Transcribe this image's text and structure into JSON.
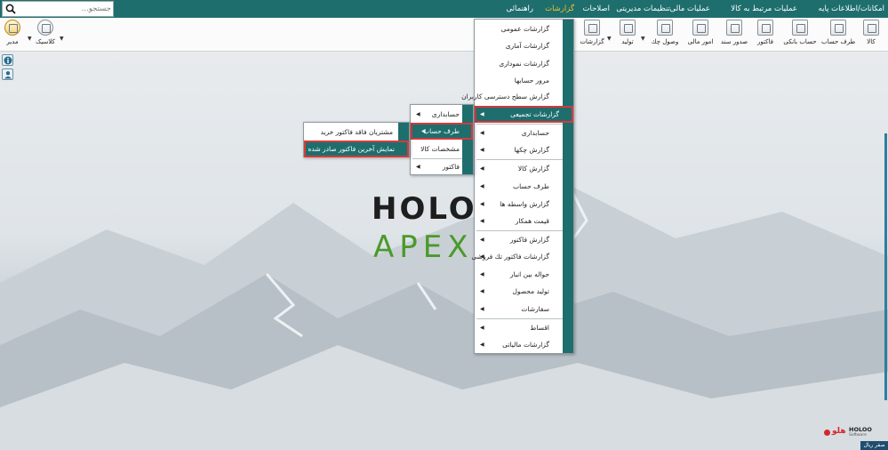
{
  "menubar": {
    "items": [
      "امکانات/اطلاعات پایه",
      "عملیات مرتبط به کالا",
      "عملیات مالی",
      "تنظیمات مدیریتی",
      "اصلاحات",
      "گزارشات",
      "راهنمائی"
    ],
    "active_index": 5,
    "accent_color": "#f2c230",
    "bar_color": "#1f6e6e"
  },
  "search": {
    "placeholder": "جستجو..."
  },
  "toolbar": {
    "right_buttons": [
      "کالا",
      "طرف حساب",
      "حساب بانکی",
      "فاکتور",
      "صدور سند",
      "امور مالی",
      "وصول چك",
      "تولید",
      "گزارشات"
    ],
    "left_buttons": [
      "مدیر",
      "کلاسیک"
    ]
  },
  "reports_menu": {
    "items": [
      {
        "label": "گزارشات عمومی",
        "arrow": false
      },
      {
        "label": "گزارشات آماری",
        "arrow": false
      },
      {
        "label": "گزارشات نموداری",
        "arrow": false
      },
      {
        "label": "مرور حسابها",
        "arrow": false
      },
      {
        "label": "گزارش سطح دسترسی کاربران",
        "arrow": false
      },
      {
        "label": "گزارشات تجمیعی",
        "arrow": true,
        "highlighted": true
      },
      {
        "label": "حسابداری",
        "arrow": true
      },
      {
        "label": "گزارش چکها",
        "arrow": true
      },
      {
        "label": "گزارش کالا",
        "arrow": true
      },
      {
        "label": "طرف حساب",
        "arrow": true
      },
      {
        "label": "گزارش واسطه ها",
        "arrow": true
      },
      {
        "label": "قیمت همکار",
        "arrow": true
      },
      {
        "label": "گزارش فاکتور",
        "arrow": true
      },
      {
        "label": "گزارشات فاکتور تك فروشی",
        "arrow": true
      },
      {
        "label": "حواله بین انبار",
        "arrow": true
      },
      {
        "label": "تولید محصول",
        "arrow": true
      },
      {
        "label": "سفارشات",
        "arrow": true
      },
      {
        "label": "اقساط",
        "arrow": true
      },
      {
        "label": "گزارشات مالیاتی",
        "arrow": true
      }
    ]
  },
  "aggregate_menu": {
    "items": [
      {
        "label": "حسابداری",
        "arrow": true
      },
      {
        "label": "طرف حساب",
        "arrow": true,
        "highlighted": true
      },
      {
        "label": "مشخصات کالا",
        "arrow": false
      },
      {
        "label": "فاکتور",
        "arrow": true
      }
    ]
  },
  "party_menu": {
    "items": [
      {
        "label": "مشتریان فاقد فاکتور خرید",
        "highlighted": false
      },
      {
        "label": "نمایش آخرین فاکتور صادر شده",
        "highlighted": true
      }
    ]
  },
  "brand": {
    "line1": "HOLOO",
    "line2": "APEX"
  },
  "logo": {
    "fa": "هلو",
    "en": "HOLOO",
    "sub": "Software"
  },
  "status": {
    "label": "صفر ریال"
  },
  "side_icons": [
    "info-icon",
    "user-icon"
  ]
}
